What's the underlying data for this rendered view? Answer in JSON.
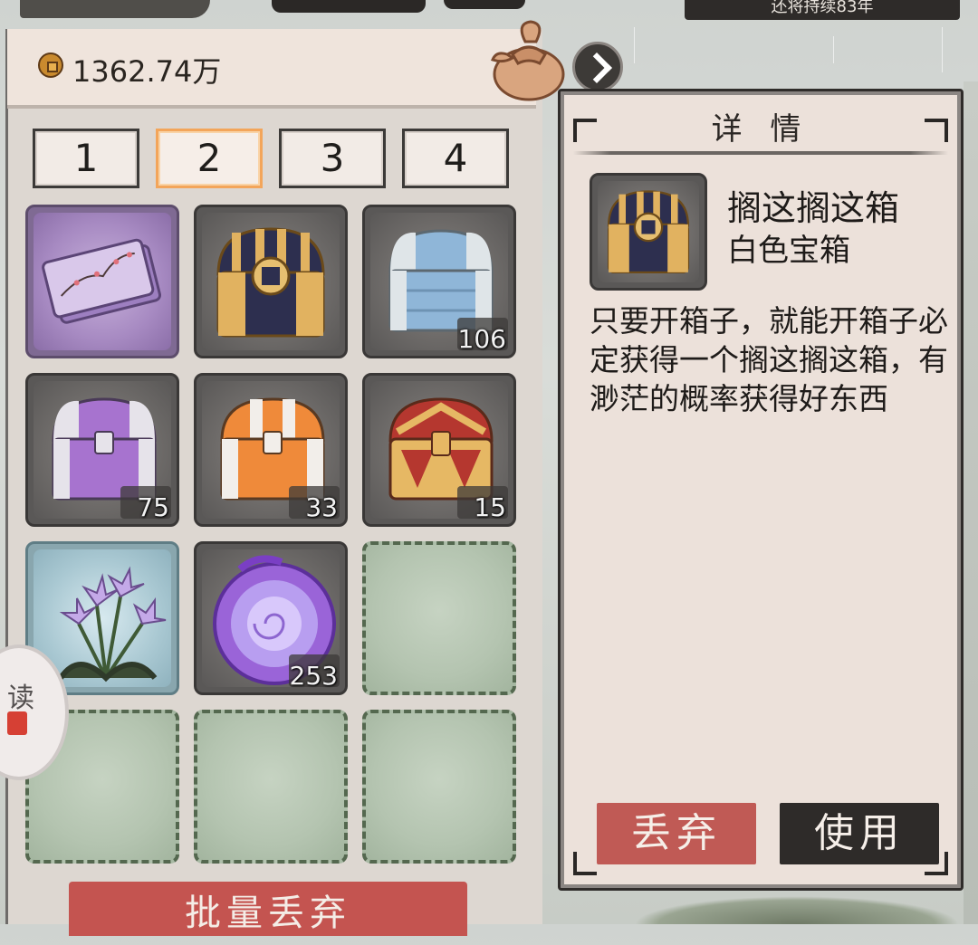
{
  "top_banner": {
    "text": "还将持续83年"
  },
  "currency": {
    "value": "1362.74万",
    "icon": "copper-coin-icon"
  },
  "tabs": [
    {
      "label": "1",
      "active": false
    },
    {
      "label": "2",
      "active": true
    },
    {
      "label": "3",
      "active": false
    },
    {
      "label": "4",
      "active": false
    }
  ],
  "inventory": [
    {
      "item": "plum-blossom-letter-icon",
      "count": "",
      "frame": "purple"
    },
    {
      "item": "navy-gold-chest-icon",
      "count": "",
      "frame": "gray"
    },
    {
      "item": "blue-chest-icon",
      "count": "106",
      "frame": "gray"
    },
    {
      "item": "purple-chest-icon",
      "count": "75",
      "frame": "gray"
    },
    {
      "item": "orange-chest-icon",
      "count": "33",
      "frame": "gray"
    },
    {
      "item": "red-gold-chest-icon",
      "count": "15",
      "frame": "gray"
    },
    {
      "item": "lily-flower-icon",
      "count": "",
      "frame": "blue"
    },
    {
      "item": "purple-vortex-icon",
      "count": "253",
      "frame": "gray"
    },
    {
      "item": "",
      "count": "",
      "frame": "empty"
    },
    {
      "item": "",
      "count": "",
      "frame": "empty"
    },
    {
      "item": "",
      "count": "",
      "frame": "empty"
    },
    {
      "item": "",
      "count": "",
      "frame": "empty"
    }
  ],
  "batch_discard_label": "批量丢弃",
  "side_badge_label": "读",
  "detail": {
    "title": "详 情",
    "item_name": "搁这搁这箱",
    "item_rarity": "白色宝箱",
    "description": "只要开箱子，就能开箱子必定获得一个搁这搁这箱，有渺茫的概率获得好东西",
    "discard_label": "丢弃",
    "use_label": "使用"
  },
  "colors": {
    "discard": "#c05a55",
    "use": "#2e2b29",
    "active_tab": "#f3a55a",
    "empty_slot_border": "#54684f"
  }
}
